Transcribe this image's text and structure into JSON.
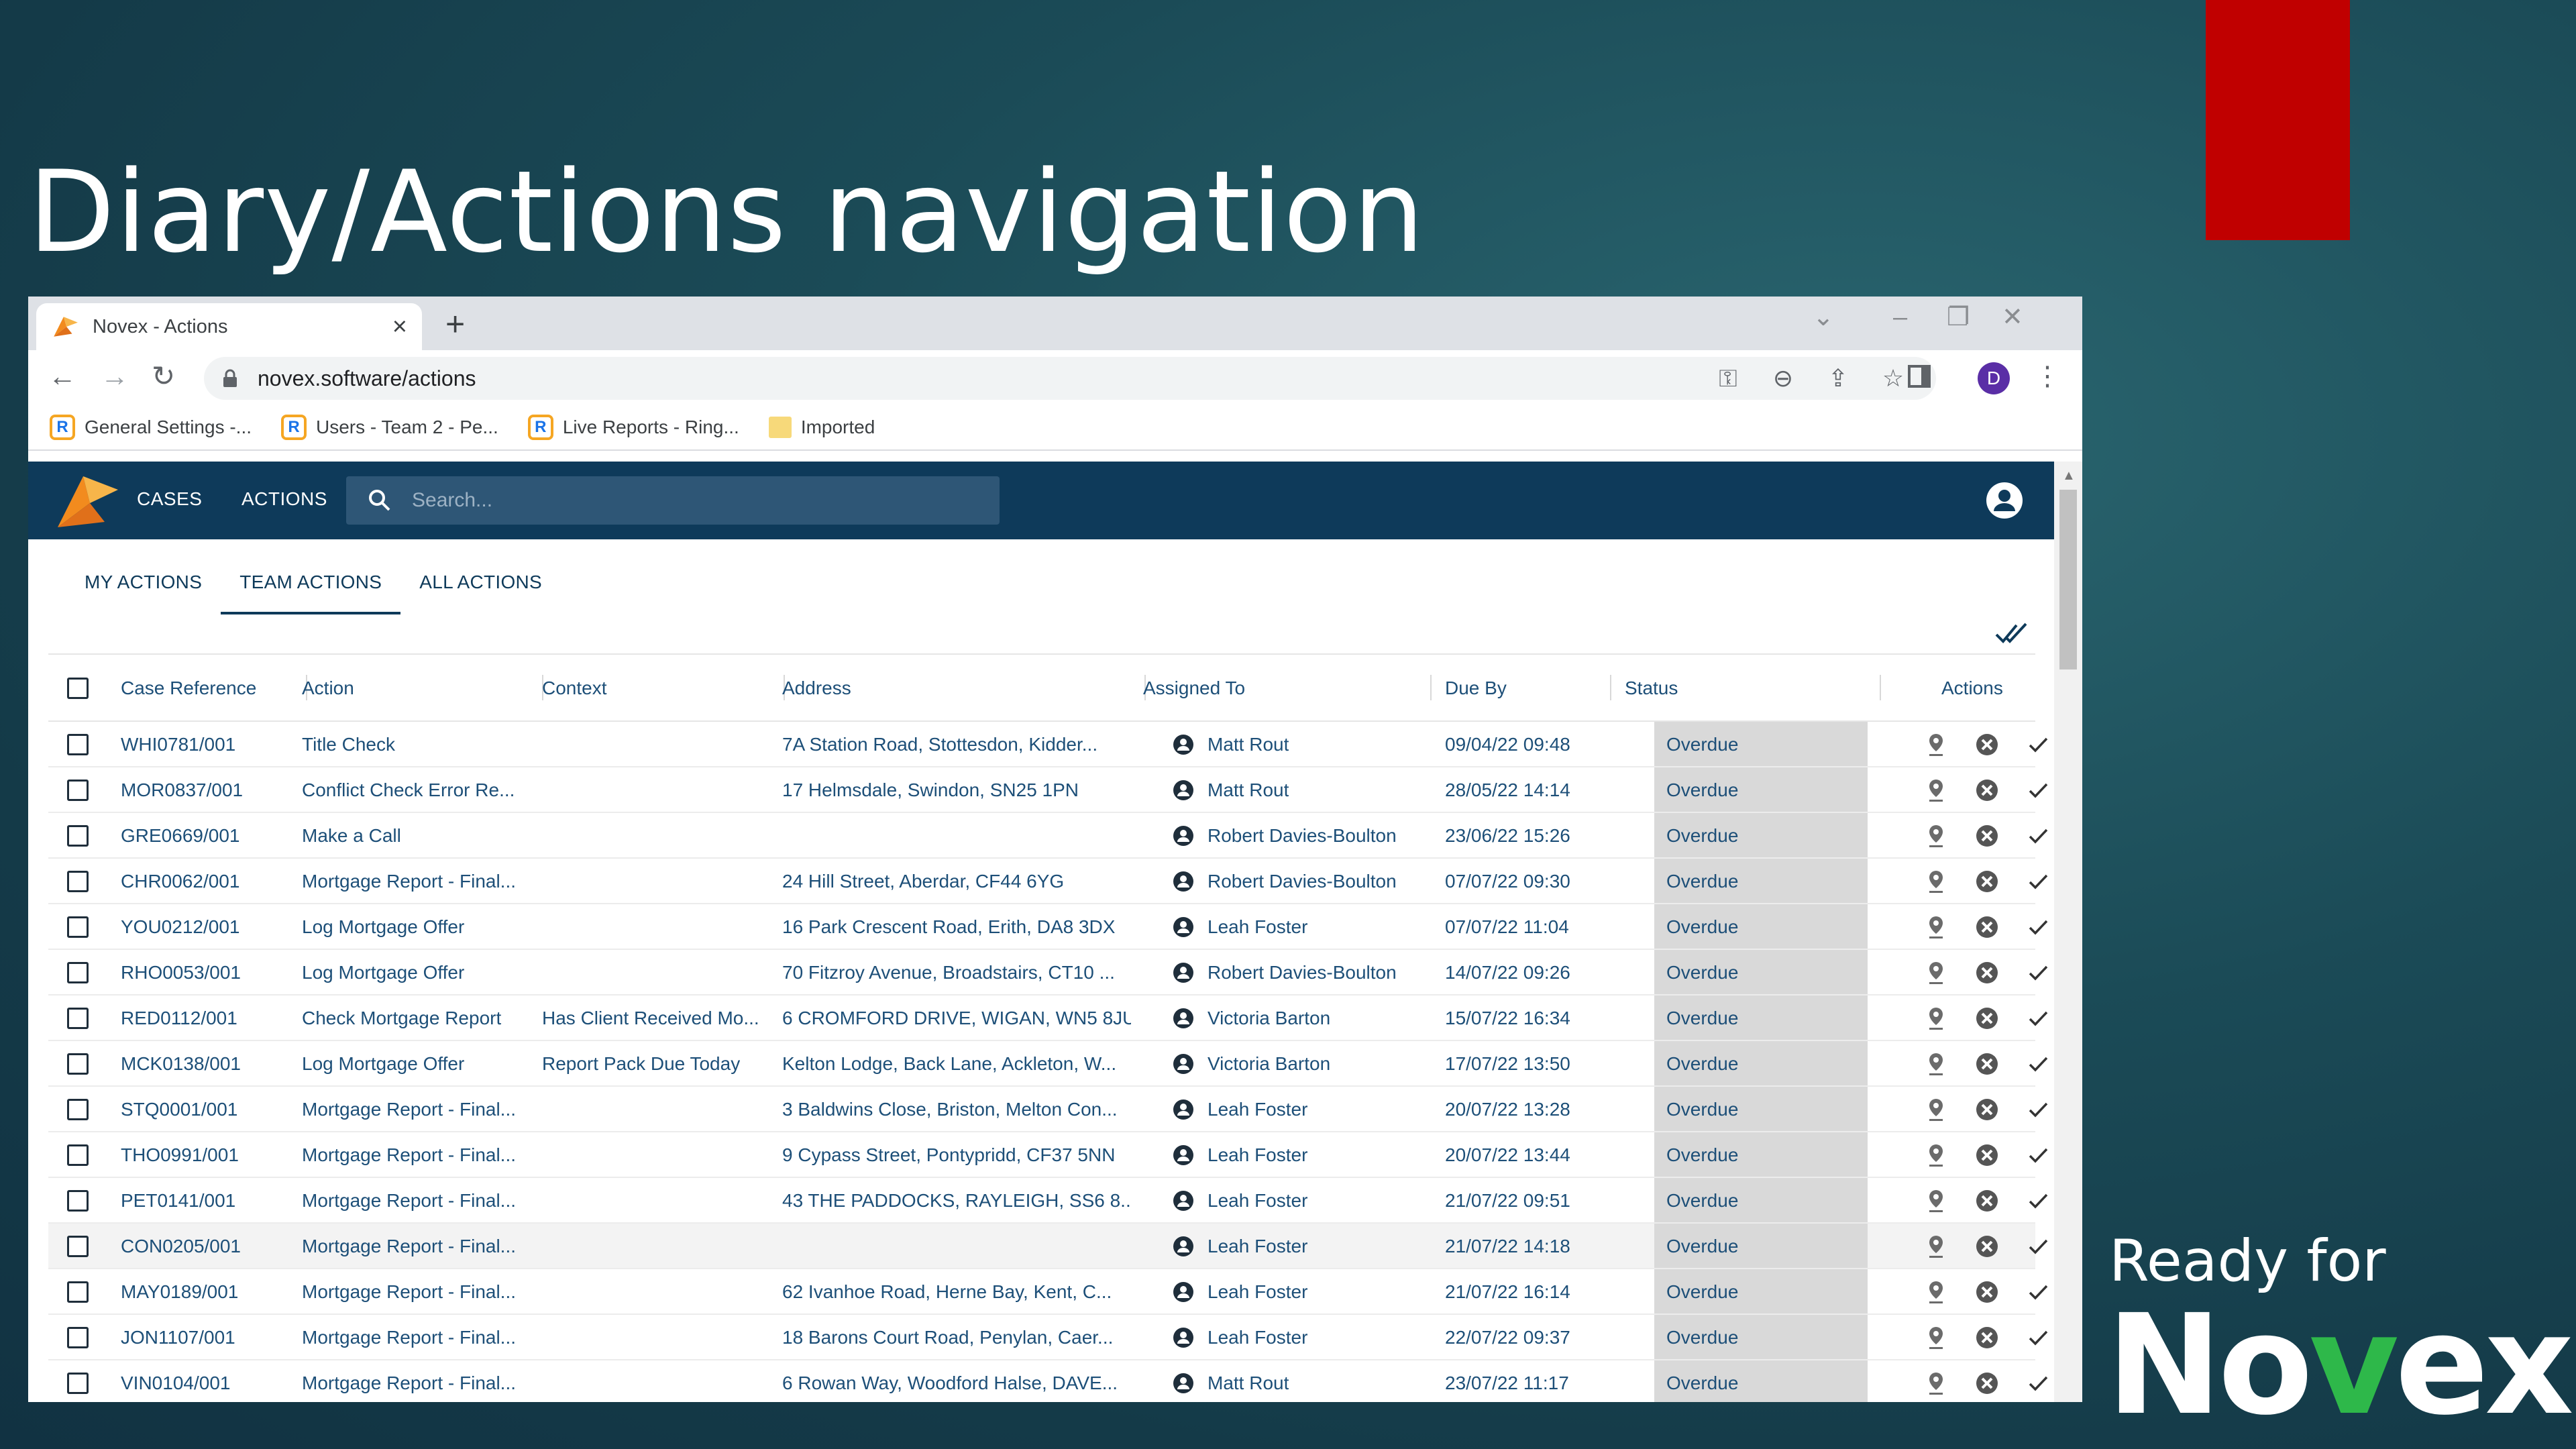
{
  "slide": {
    "title": "Diary/Actions navigation",
    "brand_line1": "Ready for",
    "brand_no": "No",
    "brand_v": "v",
    "brand_ex": "ex",
    "colors": {
      "accent_red": "#c00000",
      "brand_green": "#2eb84a"
    }
  },
  "browser": {
    "tab_title": "Novex - Actions",
    "url": "novex.software/actions",
    "profile_initial": "D",
    "bookmarks": [
      {
        "label": "General Settings -..."
      },
      {
        "label": "Users - Team 2 - Pe..."
      },
      {
        "label": "Live Reports - Ring..."
      },
      {
        "label": "Imported"
      }
    ]
  },
  "app": {
    "nav": {
      "cases": "CASES",
      "actions": "ACTIONS"
    },
    "search_placeholder": "Search...",
    "subtabs": [
      "MY ACTIONS",
      "TEAM ACTIONS",
      "ALL ACTIONS"
    ],
    "active_subtab": "TEAM ACTIONS",
    "colors": {
      "header_bg": "#0e3a5a",
      "status_bg": "#d9d9d9",
      "text": "#1d4f78"
    },
    "table": {
      "columns": [
        "Case Reference",
        "Action",
        "Context",
        "Address",
        "Assigned To",
        "Due By",
        "Status",
        "Actions"
      ],
      "rows": [
        [
          "WHI0781/001",
          "Title Check",
          "",
          "7A Station Road, Stottesdon, Kidder...",
          "Matt Rout",
          "09/04/22 09:48",
          "Overdue"
        ],
        [
          "MOR0837/001",
          "Conflict Check Error Re...",
          "",
          "17 Helmsdale, Swindon, SN25 1PN",
          "Matt Rout",
          "28/05/22 14:14",
          "Overdue"
        ],
        [
          "GRE0669/001",
          "Make a Call",
          "",
          "",
          "Robert Davies-Boulton",
          "23/06/22 15:26",
          "Overdue"
        ],
        [
          "CHR0062/001",
          "Mortgage Report - Final...",
          "",
          "24 Hill Street, Aberdar, CF44 6YG",
          "Robert Davies-Boulton",
          "07/07/22 09:30",
          "Overdue"
        ],
        [
          "YOU0212/001",
          "Log Mortgage Offer",
          "",
          "16 Park Crescent Road, Erith, DA8 3DX",
          "Leah Foster",
          "07/07/22 11:04",
          "Overdue"
        ],
        [
          "RHO0053/001",
          "Log Mortgage Offer",
          "",
          "70 Fitzroy Avenue, Broadstairs, CT10 ...",
          "Robert Davies-Boulton",
          "14/07/22 09:26",
          "Overdue"
        ],
        [
          "RED0112/001",
          "Check Mortgage Report",
          "Has Client Received Mo...",
          "6 CROMFORD DRIVE, WIGAN, WN5 8JU",
          "Victoria Barton",
          "15/07/22 16:34",
          "Overdue"
        ],
        [
          "MCK0138/001",
          "Log Mortgage Offer",
          "Report Pack Due Today",
          "Kelton Lodge, Back Lane, Ackleton, W...",
          "Victoria Barton",
          "17/07/22 13:50",
          "Overdue"
        ],
        [
          "STQ0001/001",
          "Mortgage Report - Final...",
          "",
          "3 Baldwins Close, Briston, Melton Con...",
          "Leah Foster",
          "20/07/22 13:28",
          "Overdue"
        ],
        [
          "THO0991/001",
          "Mortgage Report - Final...",
          "",
          "9 Cypass Street, Pontypridd, CF37 5NN",
          "Leah Foster",
          "20/07/22 13:44",
          "Overdue"
        ],
        [
          "PET0141/001",
          "Mortgage Report - Final...",
          "",
          "43 THE PADDOCKS, RAYLEIGH, SS6 8...",
          "Leah Foster",
          "21/07/22 09:51",
          "Overdue"
        ],
        [
          "CON0205/001",
          "Mortgage Report - Final...",
          "",
          "",
          "Leah Foster",
          "21/07/22 14:18",
          "Overdue"
        ],
        [
          "MAY0189/001",
          "Mortgage Report - Final...",
          "",
          "62 Ivanhoe Road, Herne Bay, Kent, C...",
          "Leah Foster",
          "21/07/22 16:14",
          "Overdue"
        ],
        [
          "JON1107/001",
          "Mortgage Report - Final...",
          "",
          "18 Barons Court Road, Penylan, Caer...",
          "Leah Foster",
          "22/07/22 09:37",
          "Overdue"
        ],
        [
          "VIN0104/001",
          "Mortgage Report - Final...",
          "",
          "6 Rowan Way, Woodford Halse, DAVE...",
          "Matt Rout",
          "23/07/22 11:17",
          "Overdue"
        ]
      ],
      "highlighted_row_index": 11
    }
  }
}
